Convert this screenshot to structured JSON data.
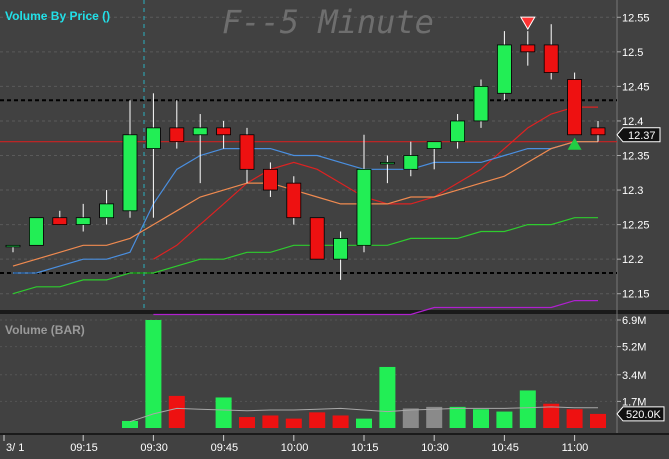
{
  "chart_data": {
    "type": "candlestick",
    "title": "Volume By Price ()",
    "watermark": "F--5 Minute",
    "price_axis": {
      "ylim": [
        12.125,
        12.575
      ],
      "ticks": [
        12.55,
        12.5,
        12.45,
        12.4,
        12.35,
        12.3,
        12.25,
        12.2,
        12.15
      ],
      "tick_labels": [
        "12.55",
        "12.5",
        "12.45",
        "12.4",
        "12.35",
        "12.3",
        "12.25",
        "12.2",
        "12.15"
      ],
      "last_price_label": "12.37"
    },
    "time_axis": {
      "labels": [
        "3/ 1",
        "09:15",
        "09:30",
        "09:45",
        "10:00",
        "10:15",
        "10:30",
        "10:45",
        "11:00"
      ],
      "label_bar_index": [
        0,
        3,
        6,
        9,
        12,
        15,
        18,
        21,
        24
      ]
    },
    "candles": [
      {
        "o": 12.22,
        "h": 12.22,
        "l": 12.21,
        "c": 12.22
      },
      {
        "o": 12.22,
        "h": 12.26,
        "l": 12.22,
        "c": 12.26
      },
      {
        "o": 12.26,
        "h": 12.27,
        "l": 12.25,
        "c": 12.25
      },
      {
        "o": 12.25,
        "h": 12.28,
        "l": 12.24,
        "c": 12.26
      },
      {
        "o": 12.26,
        "h": 12.3,
        "l": 12.25,
        "c": 12.28
      },
      {
        "o": 12.27,
        "h": 12.43,
        "l": 12.26,
        "c": 12.38
      },
      {
        "o": 12.36,
        "h": 12.44,
        "l": 12.26,
        "c": 12.39
      },
      {
        "o": 12.39,
        "h": 12.43,
        "l": 12.36,
        "c": 12.37
      },
      {
        "o": 12.38,
        "h": 12.41,
        "l": 12.31,
        "c": 12.39
      },
      {
        "o": 12.39,
        "h": 12.4,
        "l": 12.36,
        "c": 12.38
      },
      {
        "o": 12.38,
        "h": 12.39,
        "l": 12.31,
        "c": 12.33
      },
      {
        "o": 12.33,
        "h": 12.34,
        "l": 12.29,
        "c": 12.3
      },
      {
        "o": 12.31,
        "h": 12.32,
        "l": 12.25,
        "c": 12.26
      },
      {
        "o": 12.26,
        "h": 12.26,
        "l": 12.2,
        "c": 12.2
      },
      {
        "o": 12.2,
        "h": 12.24,
        "l": 12.17,
        "c": 12.23
      },
      {
        "o": 12.22,
        "h": 12.38,
        "l": 12.21,
        "c": 12.33
      },
      {
        "o": 12.34,
        "h": 12.35,
        "l": 12.31,
        "c": 12.34
      },
      {
        "o": 12.33,
        "h": 12.37,
        "l": 12.32,
        "c": 12.35
      },
      {
        "o": 12.36,
        "h": 12.37,
        "l": 12.33,
        "c": 12.37
      },
      {
        "o": 12.37,
        "h": 12.41,
        "l": 12.36,
        "c": 12.4
      },
      {
        "o": 12.4,
        "h": 12.46,
        "l": 12.39,
        "c": 12.45
      },
      {
        "o": 12.44,
        "h": 12.53,
        "l": 12.43,
        "c": 12.51
      },
      {
        "o": 12.51,
        "h": 12.53,
        "l": 12.48,
        "c": 12.5
      },
      {
        "o": 12.51,
        "h": 12.54,
        "l": 12.46,
        "c": 12.47
      },
      {
        "o": 12.46,
        "h": 12.47,
        "l": 12.38,
        "c": 12.38
      },
      {
        "o": 12.39,
        "h": 12.4,
        "l": 12.37,
        "c": 12.38
      }
    ],
    "moving_averages": [
      {
        "color": "#dd2222",
        "values": [
          null,
          null,
          null,
          null,
          null,
          null,
          12.2,
          12.22,
          12.25,
          12.28,
          12.31,
          12.33,
          12.34,
          12.33,
          12.31,
          12.29,
          12.28,
          12.28,
          12.29,
          12.31,
          12.33,
          12.36,
          12.39,
          12.41,
          12.42,
          12.42
        ]
      },
      {
        "color": "#4a8fe0",
        "values": [
          12.18,
          12.18,
          12.19,
          12.2,
          12.2,
          12.21,
          12.28,
          12.33,
          12.35,
          12.36,
          12.36,
          12.36,
          12.35,
          12.35,
          12.34,
          12.33,
          12.33,
          12.33,
          12.34,
          12.34,
          12.34,
          12.35,
          12.36,
          12.36,
          12.37,
          12.37
        ]
      },
      {
        "color": "#f08a50",
        "values": [
          12.19,
          12.2,
          12.21,
          12.22,
          12.22,
          12.23,
          12.25,
          12.27,
          12.29,
          12.3,
          12.31,
          12.31,
          12.3,
          12.29,
          12.28,
          12.28,
          12.28,
          12.29,
          12.29,
          12.3,
          12.31,
          12.32,
          12.34,
          12.36,
          12.37,
          12.37
        ]
      },
      {
        "color": "#2ecc2e",
        "values": [
          12.15,
          12.16,
          12.16,
          12.17,
          12.17,
          12.18,
          12.18,
          12.19,
          12.2,
          12.2,
          12.21,
          12.21,
          12.22,
          12.22,
          12.22,
          12.22,
          12.22,
          12.23,
          12.23,
          12.23,
          12.24,
          12.24,
          12.25,
          12.25,
          12.26,
          12.26
        ]
      },
      {
        "color": "#b020d0",
        "values": [
          null,
          null,
          null,
          null,
          null,
          null,
          12.12,
          12.12,
          12.12,
          12.12,
          12.12,
          12.12,
          12.12,
          12.12,
          12.12,
          12.12,
          12.12,
          12.12,
          12.13,
          12.13,
          12.13,
          12.13,
          12.13,
          12.13,
          12.14,
          12.14
        ]
      }
    ],
    "reference_lines": [
      {
        "value": 12.43,
        "style": "dashed",
        "color": "#000000"
      },
      {
        "value": 12.37,
        "style": "solid",
        "color": "#cc2222"
      },
      {
        "value": 12.18,
        "style": "dashed",
        "color": "#000000"
      }
    ],
    "signals": [
      {
        "bar": 22,
        "type": "sell",
        "color": "#ff3333"
      },
      {
        "bar": 24,
        "type": "buy",
        "color": "#22cc44"
      }
    ],
    "volume": {
      "title": "Volume (BAR)",
      "ylim": [
        0,
        6.9
      ],
      "tick_labels": [
        "6.9M",
        "5.2M",
        "3.4M",
        "1.7M"
      ],
      "ticks": [
        6.9,
        5.2,
        3.4,
        1.7
      ],
      "last_label": "520.0K",
      "values_m": [
        0,
        0,
        0,
        0,
        0,
        0.45,
        6.9,
        2.05,
        0,
        1.95,
        0.7,
        0.8,
        0.6,
        1.0,
        0.8,
        0.6,
        3.9,
        1.25,
        1.35,
        1.35,
        1.2,
        1.05,
        2.4,
        1.55,
        1.2,
        0.9
      ],
      "colors": [
        "",
        "",
        "",
        "",
        "",
        "green",
        "green",
        "red",
        "",
        "green",
        "red",
        "red",
        "red",
        "red",
        "red",
        "green",
        "green",
        "gray",
        "gray",
        "green",
        "green",
        "green",
        "green",
        "red",
        "red",
        "red"
      ],
      "ma_m": [
        0,
        0,
        0,
        0,
        0,
        0.4,
        0.9,
        1.25,
        1.2,
        1.15,
        1.1,
        1.15,
        1.15,
        1.2,
        1.25,
        1.15,
        1.05,
        1.15,
        1.2,
        1.25,
        1.25,
        1.25,
        1.3,
        1.35,
        1.3,
        1.3
      ]
    }
  }
}
